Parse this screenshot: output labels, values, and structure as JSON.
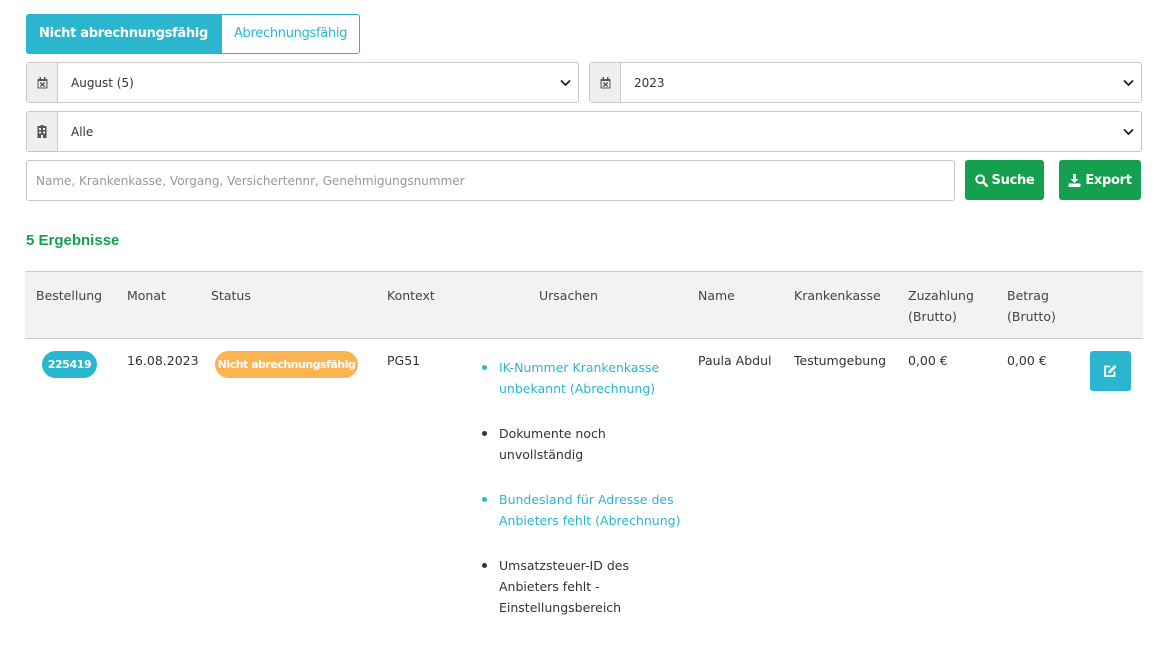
{
  "tabs": [
    {
      "label": "Nicht abrechnungsfähig",
      "active": true
    },
    {
      "label": "Abrechnungsfähig",
      "active": false
    }
  ],
  "filters": {
    "month": {
      "icon": "calendar-icon",
      "value": "August (5)"
    },
    "year": {
      "icon": "calendar-icon",
      "value": "2023"
    },
    "provider": {
      "icon": "building-icon",
      "value": "Alle"
    }
  },
  "search": {
    "value": "",
    "placeholder": "Name, Krankenkasse, Vorgang, Versichertennr, Genehmigungsnummer",
    "search_label": "Suche",
    "export_label": "Export"
  },
  "results_label": "5 Ergebnisse",
  "colors": {
    "accent": "#2bb6d0",
    "green": "#15a050",
    "warning": "#fbb44f"
  },
  "table": {
    "headers": {
      "bestellung": "Bestellung",
      "monat": "Monat",
      "status": "Status",
      "kontext": "Kontext",
      "ursachen": "Ursachen",
      "name": "Name",
      "krankenkasse": "Krankenkasse",
      "zuzahlung_1": "Zuzahlung",
      "zuzahlung_2": "(Brutto)",
      "betrag_1": "Betrag",
      "betrag_2": "(Brutto)"
    },
    "rows": [
      {
        "order": "225419",
        "month": "16.08.2023",
        "status": "Nicht abrechnungsfähig",
        "context": "PG51",
        "causes": [
          {
            "text": "IK-Nummer Krankenkasse unbekannt (Abrechnung)",
            "link": true
          },
          {
            "text": "Dokumente noch unvollständig",
            "link": false
          },
          {
            "text": "Bundesland für Adresse des Anbieters fehlt (Abrechnung)",
            "link": true
          },
          {
            "text": "Umsatzsteuer-ID des Anbieters fehlt - Einstellungsbereich",
            "link": false
          }
        ],
        "name": "Paula Abdul",
        "insurer": "Testumgebung",
        "copay": "0,00 €",
        "amount": "0,00 €",
        "action_icon": "edit-icon"
      }
    ]
  }
}
